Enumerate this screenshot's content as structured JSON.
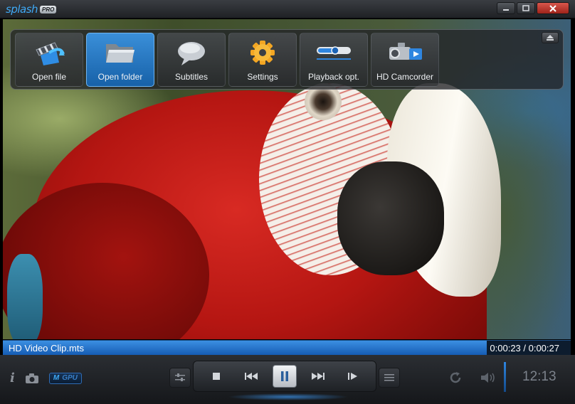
{
  "app": {
    "logo_text": "splash",
    "logo_badge": "PRO"
  },
  "window_controls": {
    "minimize": "minimize",
    "maximize": "maximize",
    "close": "close"
  },
  "toolbar": {
    "items": [
      {
        "label": "Open file",
        "icon": "clapper-board-icon",
        "active": false
      },
      {
        "label": "Open folder",
        "icon": "folder-icon",
        "active": true
      },
      {
        "label": "Subtitles",
        "icon": "speech-bubble-icon",
        "active": false
      },
      {
        "label": "Settings",
        "icon": "gear-icon",
        "active": false
      },
      {
        "label": "Playback opt.",
        "icon": "slider-icon",
        "active": false
      },
      {
        "label": "HD Camcorder",
        "icon": "camcorder-icon",
        "active": false
      }
    ]
  },
  "status": {
    "filename": "HD Video Clip.mts",
    "time": "0:00:23 / 0:00:27",
    "progress": 0.852
  },
  "controls": {
    "mgpu_m": "M",
    "mgpu_gpu": "GPU",
    "clock": "12:13"
  },
  "colors": {
    "accent": "#2f86e0",
    "active_tool": "#1f73c2"
  }
}
